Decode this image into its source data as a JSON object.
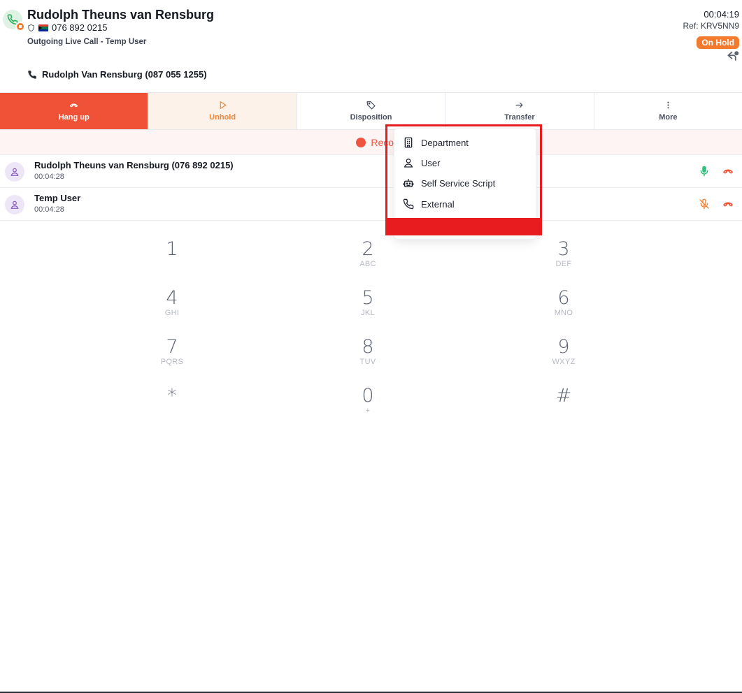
{
  "header": {
    "caller_name": "Rudolph Theuns van Rensburg",
    "caller_number": "076 892 0215",
    "subtitle": "Outgoing Live Call - Temp User",
    "timer": "00:04:19",
    "ref": "Ref: KRV5NN9",
    "status_badge": "On Hold",
    "contact_line": "Rudolph Van Rensburg (087 055 1255)"
  },
  "actions": [
    {
      "label": "Hang up",
      "icon": "hangup-icon"
    },
    {
      "label": "Unhold",
      "icon": "play-icon"
    },
    {
      "label": "Disposition",
      "icon": "tag-icon"
    },
    {
      "label": "Transfer",
      "icon": "arrow-right-icon"
    },
    {
      "label": "More",
      "icon": "more-vertical-icon"
    }
  ],
  "recording": {
    "text": "Recording is on"
  },
  "participants": [
    {
      "name": "Rudolph Theuns van Rensburg (076 892 0215)",
      "time": "00:04:28",
      "muted": false
    },
    {
      "name": "Temp User",
      "time": "00:04:28",
      "muted": true
    }
  ],
  "keypad": [
    {
      "digit": "1",
      "letters": ""
    },
    {
      "digit": "2",
      "letters": "ABC"
    },
    {
      "digit": "3",
      "letters": "DEF"
    },
    {
      "digit": "4",
      "letters": "GHI"
    },
    {
      "digit": "5",
      "letters": "JKL"
    },
    {
      "digit": "6",
      "letters": "MNO"
    },
    {
      "digit": "7",
      "letters": "PQRS"
    },
    {
      "digit": "8",
      "letters": "TUV"
    },
    {
      "digit": "9",
      "letters": "WXYZ"
    },
    {
      "digit": "*",
      "letters": ""
    },
    {
      "digit": "0",
      "letters": "+"
    },
    {
      "digit": "#",
      "letters": ""
    }
  ],
  "transfer_menu": {
    "items": [
      {
        "label": "Department",
        "icon": "building-icon"
      },
      {
        "label": "User",
        "icon": "user-icon"
      },
      {
        "label": "Self Service Script",
        "icon": "robot-icon"
      },
      {
        "label": "External",
        "icon": "phone-icon"
      }
    ]
  },
  "colors": {
    "hangup": "#ef5236",
    "unhold_bg": "#fdf2e9",
    "accent_orange": "#f47a2e",
    "recording": "#ee5440",
    "highlight": "#e81b1f"
  }
}
